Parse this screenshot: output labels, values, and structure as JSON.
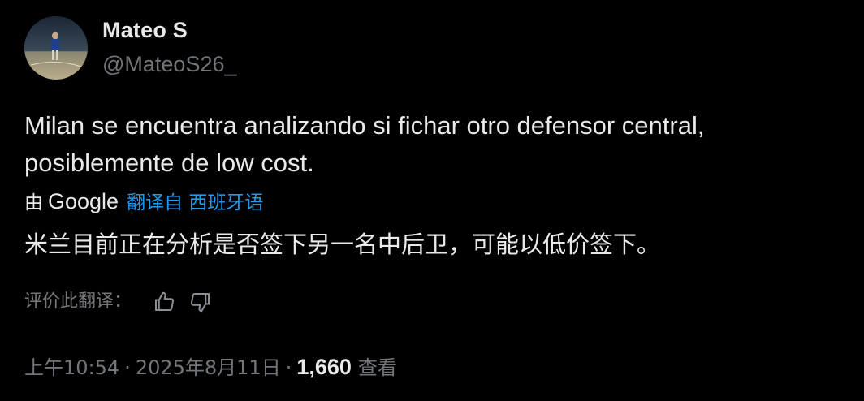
{
  "author": {
    "display_name": "Mateo S",
    "handle": "@MateoS26_"
  },
  "tweet": {
    "text": "Milan se encuentra analizando si fichar otro defensor central, posiblemente de low cost."
  },
  "translation": {
    "by_label": "由",
    "provider": "Google",
    "translated_from": "翻译自 西班牙语",
    "text": "米兰目前正在分析是否签下另一名中后卫，可能以低价签下。",
    "rate_label": "评价此翻译："
  },
  "meta": {
    "time": "上午10:54",
    "separator": "·",
    "date": "2025年8月11日",
    "views_count": "1,660",
    "views_label": "查看"
  },
  "colors": {
    "background": "#000000",
    "primary_text": "#e7e9ea",
    "secondary_text": "#71767b",
    "link": "#1d9bf0"
  },
  "icons": {
    "thumbs_up": "thumbs-up-icon",
    "thumbs_down": "thumbs-down-icon"
  }
}
